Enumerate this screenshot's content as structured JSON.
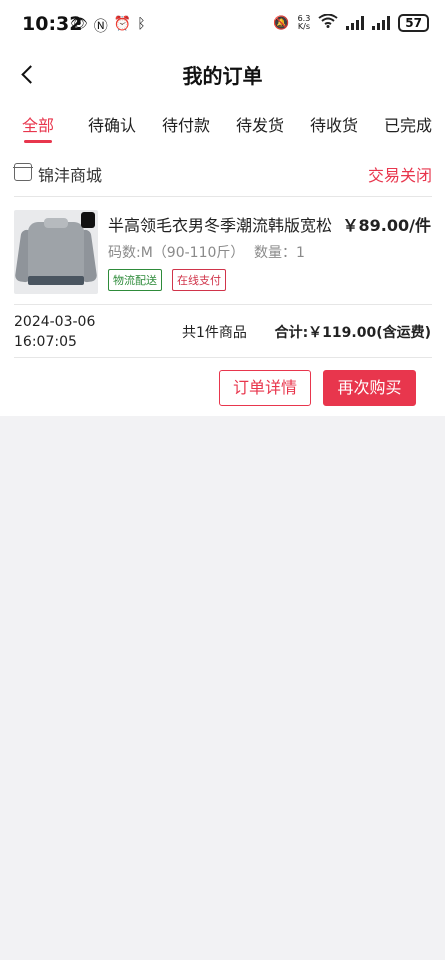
{
  "status_bar": {
    "time": "10:32",
    "left_icons": [
      "eye-icon",
      "nfc-icon",
      "alarm-icon",
      "bluetooth-icon"
    ],
    "net_speed_value": "6.3",
    "net_speed_unit": "K/s",
    "battery": "57"
  },
  "header": {
    "title": "我的订单"
  },
  "tabs": [
    {
      "label": "全部",
      "active": true
    },
    {
      "label": "待确认",
      "active": false
    },
    {
      "label": "待付款",
      "active": false
    },
    {
      "label": "待发货",
      "active": false
    },
    {
      "label": "待收货",
      "active": false
    },
    {
      "label": "已完成",
      "active": false
    }
  ],
  "order": {
    "shop_name": "锦沣商城",
    "status": "交易关闭",
    "product": {
      "name": "半高领毛衣男冬季潮流韩版宽松",
      "price": "￥89.00/件",
      "spec": "码数:M（90-110斤）",
      "quantity": "数量：1",
      "tags": [
        "物流配送",
        "在线支付"
      ]
    },
    "date": "2024-03-06",
    "time": "16:07:05",
    "item_count": "共1件商品",
    "total": "合计:￥119.00(含运费)",
    "buttons": {
      "detail": "订单详情",
      "rebuy": "再次购买"
    }
  },
  "colors": {
    "accent": "#e8364d",
    "tag_green": "#2e8b3a",
    "background": "#f2f2f4"
  }
}
